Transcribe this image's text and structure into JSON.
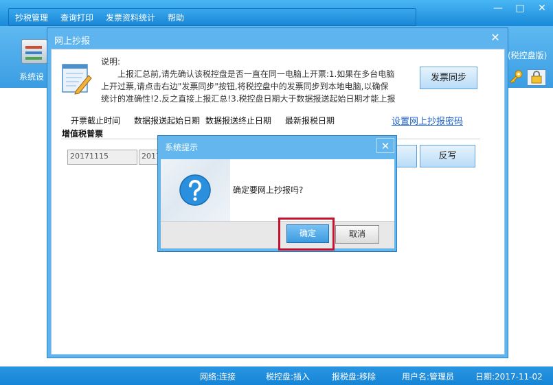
{
  "menu": {
    "items": [
      "抄税管理",
      "查询打印",
      "发票资料统计",
      "帮助"
    ]
  },
  "window_controls": {
    "minimize": "—",
    "maximize": "□",
    "close": "✕"
  },
  "toolbar": {
    "settings_label": "系统设",
    "edition_label": "(税控盘版)"
  },
  "report_dialog": {
    "title": "网上抄报",
    "close": "✕",
    "desc_title": "说明:",
    "desc_lines": [
      "上报汇总前,请先确认该税控盘是否一直在同一电脑上开票:1.如果在多台电脑",
      "上开过票,请点击右边\"发票同步\"按钮,将税控盘中的发票同步到本地电脑,以确保",
      "统计的准确性!2.反之直接上报汇总!3.税控盘日期大于数据报送起始日期才能上报"
    ],
    "sync_button": "发票同步",
    "columns": [
      "开票截止时间",
      "数据报送起始日期",
      "数据报送终止日期",
      "最新报税日期"
    ],
    "set_password_link": "设置网上抄报密码",
    "vat_label": "增值税普票",
    "fields": [
      "20171115",
      "2017"
    ],
    "writeback_button": "反写"
  },
  "prompt_dialog": {
    "title": "系统提示",
    "close": "✕",
    "message": "确定要网上抄报吗?",
    "confirm_button": "确定",
    "cancel_button": "取消"
  },
  "statusbar": {
    "network": "网络:连接",
    "tax_disk": "税控盘:插入",
    "report_disk": "报税盘:移除",
    "user": "用户名:管理员",
    "date": "日期:2017-11-02"
  },
  "colors": {
    "accent": "#1f9be8",
    "highlight": "#c8102e",
    "link": "#1f62c8"
  }
}
